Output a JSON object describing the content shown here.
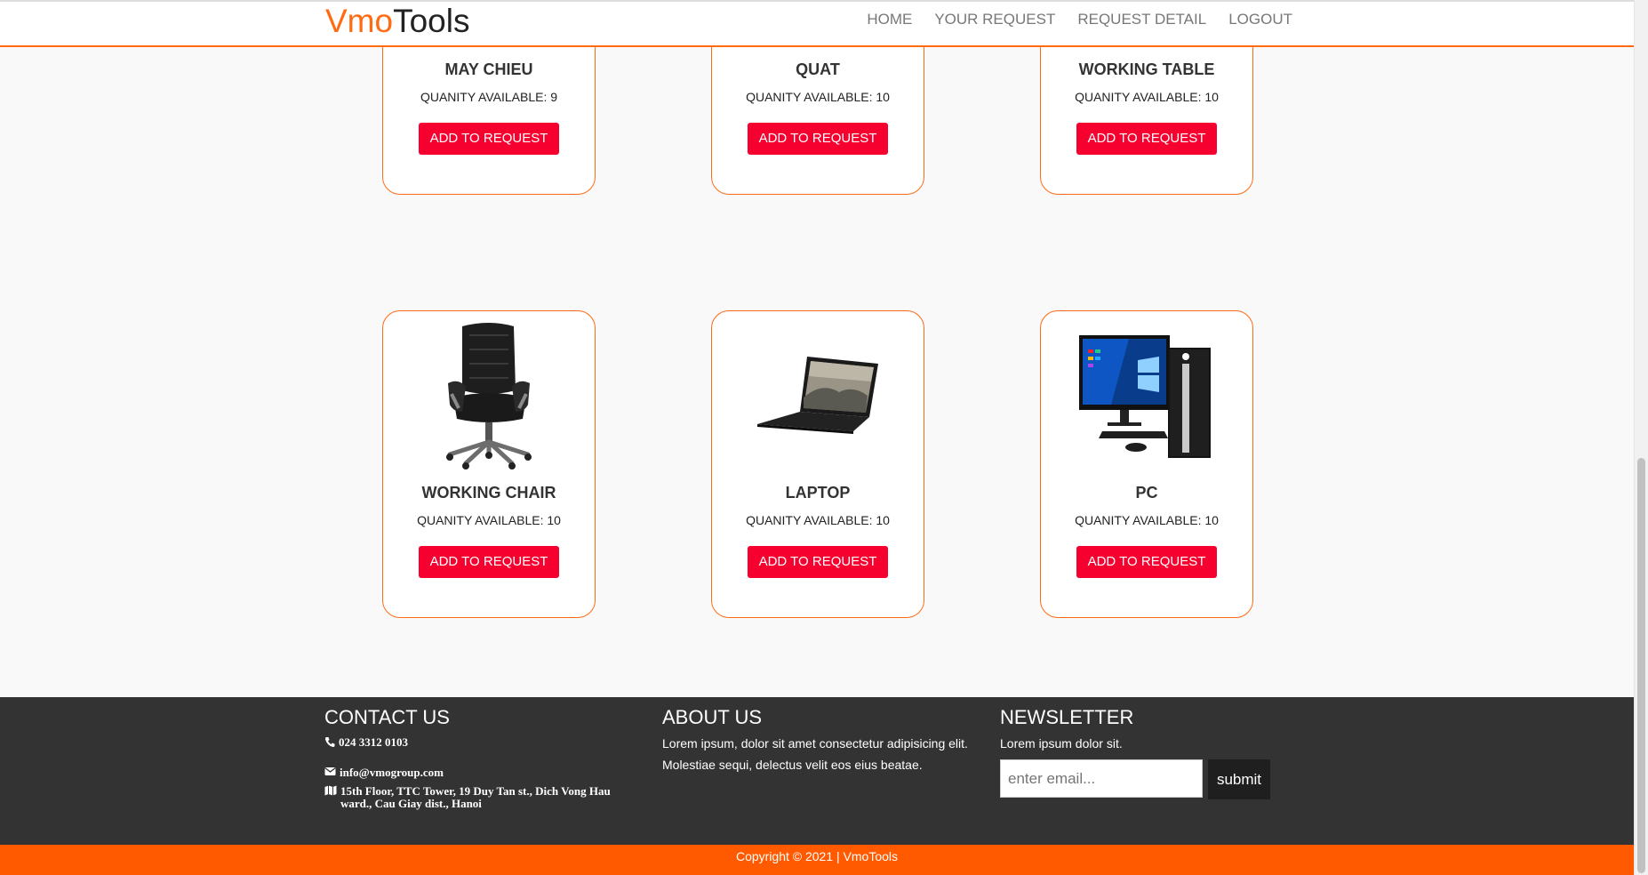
{
  "brand": {
    "part1": "Vmo",
    "part2": "Tools"
  },
  "nav": {
    "items": [
      {
        "label": "HOME"
      },
      {
        "label": "YOUR REQUEST"
      },
      {
        "label": "REQUEST DETAIL"
      },
      {
        "label": "LOGOUT"
      }
    ]
  },
  "products": [
    {
      "name": "MAY CHIEU",
      "qty": "QUANITY AVAILABLE: 9",
      "button": "ADD TO REQUEST"
    },
    {
      "name": "QUAT",
      "qty": "QUANITY AVAILABLE: 10",
      "button": "ADD TO REQUEST"
    },
    {
      "name": "WORKING TABLE",
      "qty": "QUANITY AVAILABLE: 10",
      "button": "ADD TO REQUEST"
    },
    {
      "name": "WORKING CHAIR",
      "qty": "QUANITY AVAILABLE: 10",
      "button": "ADD TO REQUEST",
      "image_icon": "office-chair-icon"
    },
    {
      "name": "LAPTOP",
      "qty": "QUANITY AVAILABLE: 10",
      "button": "ADD TO REQUEST",
      "image_icon": "laptop-icon"
    },
    {
      "name": "PC",
      "qty": "QUANITY AVAILABLE: 10",
      "button": "ADD TO REQUEST",
      "image_icon": "desktop-pc-icon"
    }
  ],
  "footer": {
    "contact": {
      "heading": "CONTACT US",
      "phone": "024 3312 0103",
      "email": "info@vmogroup.com",
      "address": "15th Floor, TTC Tower, 19 Duy Tan st., Dich Vong Hau ward., Cau Giay dist., Hanoi"
    },
    "about": {
      "heading": "ABOUT US",
      "text": "Lorem ipsum, dolor sit amet consectetur adipisicing elit. Molestiae sequi, delectus velit eos eius beatae."
    },
    "newsletter": {
      "heading": "NEWSLETTER",
      "text": "Lorem ipsum dolor sit.",
      "placeholder": "enter email...",
      "button": "submit"
    },
    "copyright": "Copyright © 2021 | VmoTools"
  },
  "colors": {
    "accent": "#ff6a13",
    "button": "#f5002f",
    "footer_bg": "#333333",
    "copyright_bg": "#ff5a00"
  }
}
